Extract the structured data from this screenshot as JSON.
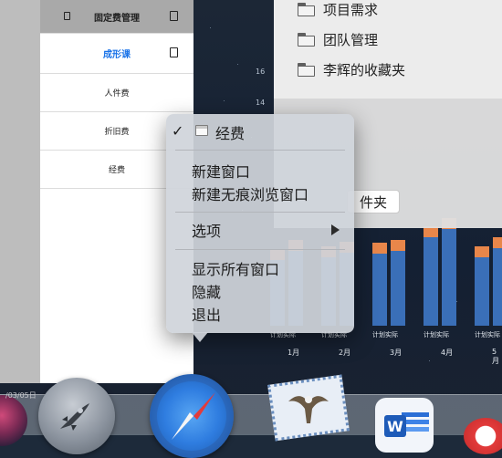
{
  "sidebar": {
    "header": "固定费管理",
    "course": "成形课",
    "items": [
      "人件费",
      "折旧费",
      "经费"
    ]
  },
  "chart": {
    "y_ticks": [
      "16",
      "14"
    ],
    "x_labels": [
      "计划实际",
      "计划实际",
      "计划实际",
      "计划实际",
      "计划实际"
    ],
    "months": [
      "1月",
      "2月",
      "3月",
      "4月",
      "5月"
    ]
  },
  "chart_data": {
    "type": "bar",
    "categories": [
      "1月",
      "2月",
      "3月",
      "4月",
      "5月"
    ],
    "xlabel": "",
    "ylabel": "",
    "series": [
      {
        "values": [
          6.0,
          6.2,
          6.5,
          7.8,
          6.2
        ]
      },
      {
        "values": [
          6.7,
          6.6,
          6.7,
          8.4,
          6.9
        ]
      }
    ],
    "colors": {
      "base": "#3a6fb8",
      "top": "#e8864a"
    }
  },
  "finder": {
    "folders": [
      "项目需求",
      "团队管理",
      "李辉的收藏夹"
    ],
    "field_text": "件夹"
  },
  "context_menu": {
    "items": [
      {
        "label": "经费",
        "checked": true
      },
      {
        "label": "新建窗口"
      },
      {
        "label": "新建无痕浏览窗口"
      },
      {
        "label": "选项",
        "submenu": true
      },
      {
        "label": "显示所有窗口"
      },
      {
        "label": "隐藏"
      },
      {
        "label": "退出"
      }
    ]
  },
  "dock": {
    "label_fragment": "/03/05日",
    "word_letter": "W",
    "apps": [
      "siri-icon",
      "launchpad-icon",
      "safari-icon",
      "mail-icon",
      "word-icon",
      "app-icon"
    ]
  }
}
